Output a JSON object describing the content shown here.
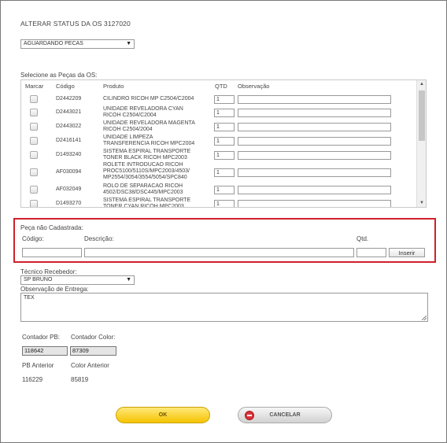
{
  "title": "ALTERAR STATUS DA OS 3127020",
  "status_select": {
    "value": "AGUARDANDO PECAS",
    "caret": "▼"
  },
  "parts": {
    "label": "Selecione as Peças da OS:",
    "headers": {
      "marcar": "Marcar",
      "codigo": "Código",
      "produto": "Produto",
      "qtd": "QTD",
      "observacao": "Observação"
    },
    "rows": [
      {
        "code": "D2442209",
        "product": "CILINDRO RICOH MP C2504/C2004",
        "qty": "1",
        "checked": false
      },
      {
        "code": "D2443021",
        "product": "UNIDADE REVELADORA CYAN\nRICOH C2504/C2004",
        "qty": "1",
        "checked": false
      },
      {
        "code": "D2443022",
        "product": "UNIDADE REVELADORA MAGENTA\nRICOH C2504/2004",
        "qty": "1",
        "checked": false
      },
      {
        "code": "D2416141",
        "product": "UNIDADE LIMPEZA\nTRANSFERENCIA RICOH MPC2004",
        "qty": "1",
        "checked": false
      },
      {
        "code": "D1493240",
        "product": "SISTEMA ESPIRAL TRANSPORTE\nTONER BLACK RICOH MPC2003",
        "qty": "1",
        "checked": false
      },
      {
        "code": "AF030094",
        "product": "ROLETE INTRODUCAO RICOH\nPROC5100/5110S/MPC2003/4503/\nMP2554/3054/3554/5054/SPC840",
        "qty": "1",
        "checked": false
      },
      {
        "code": "AF032049",
        "product": "ROLO DE SEPARACAO RICOH\n4502/DSC38/DSC445/MPC2003",
        "qty": "1",
        "checked": false
      },
      {
        "code": "D1493270",
        "product": "SISTEMA ESPIRAL TRANSPORTE\nTONER CYAN RICOH MPC2003",
        "qty": "1",
        "checked": false
      }
    ],
    "scroll_up": "▲",
    "scroll_down": "▼"
  },
  "unregistered": {
    "section_label": "Peça não Cadastrada:",
    "code_label": "Código:",
    "desc_label": "Descrição:",
    "qty_label": "Qtd.",
    "code_value": "",
    "desc_value": "",
    "qty_value": "",
    "insert_label": "Inserir"
  },
  "technician": {
    "label": "Técnico Recebedor:",
    "value": "SP BRUNO",
    "caret": "▼"
  },
  "delivery_note": {
    "label": "Observação de Entrega:",
    "value": "TEX"
  },
  "counters": {
    "pb_label": "Contador PB:",
    "color_label": "Contador Color:",
    "pb_value": "118642",
    "color_value": "87309",
    "pb_prev_label": "PB Anterior",
    "color_prev_label": "Color Anterior",
    "pb_prev_value": "116229",
    "color_prev_value": "85819"
  },
  "buttons": {
    "ok": "OK",
    "cancel": "CANCELAR"
  },
  "colors": {
    "highlight_border": "#d0202a",
    "ok_button": "#f5c400",
    "cancel_icon": "#d9343a"
  }
}
